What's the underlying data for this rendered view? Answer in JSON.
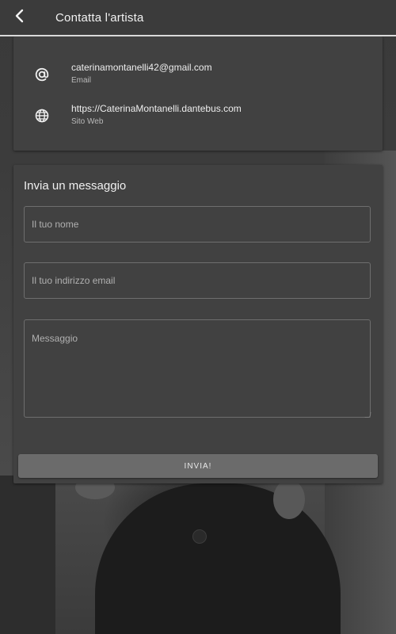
{
  "appbar": {
    "title": "Contatta l'artista",
    "back_icon": "chevron-left-icon"
  },
  "contacts": [
    {
      "icon": "at-sign-icon",
      "value": "caterinamontanelli42@gmail.com",
      "label": "Email"
    },
    {
      "icon": "globe-icon",
      "value": "https://CaterinaMontanelli.dantebus.com",
      "label": "Sito Web"
    }
  ],
  "form": {
    "title": "Invia un messaggio",
    "name_placeholder": "Il tuo nome",
    "email_placeholder": "Il tuo indirizzo email",
    "message_placeholder": "Messaggio",
    "submit_label": "INVIA!"
  },
  "colors": {
    "appbar_bg": "#3b3b3b",
    "card_bg": "#414141",
    "button_bg": "#6b6b6b",
    "divider": "#d9d9d9"
  }
}
